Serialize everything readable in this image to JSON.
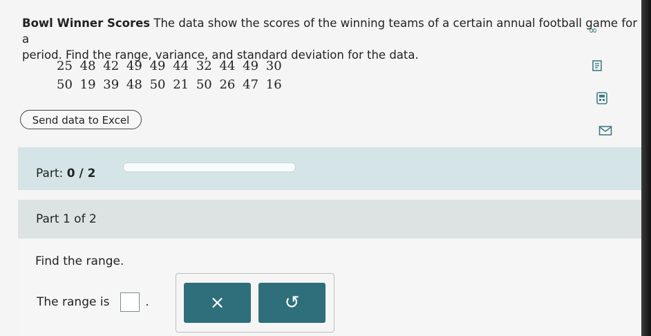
{
  "problem": {
    "title": "Bowl Winner Scores",
    "text": "The data show the scores of the winning teams of a certain annual football game for a",
    "text2": "period. Find the range, variance, and standard deviation for the data."
  },
  "data": {
    "row1": [
      "25",
      "48",
      "42",
      "49",
      "49",
      "44",
      "32",
      "44",
      "49",
      "30"
    ],
    "row2": [
      "50",
      "19",
      "39",
      "48",
      "50",
      "21",
      "50",
      "26",
      "47",
      "16"
    ]
  },
  "excel_button": "Send data to Excel",
  "side_icons": [
    "infinity-icon",
    "worksheet-icon",
    "calculator-icon",
    "mail-icon"
  ],
  "part_progress": {
    "label": "Part:",
    "current": "0 / 2",
    "value": 0
  },
  "part_heading": "Part 1 of 2",
  "question": {
    "prompt": "Find the range.",
    "answer_label": "The range is",
    "answer_value": "",
    "period": "."
  },
  "tools": {
    "clear": "×",
    "undo": "↺"
  },
  "colors": {
    "teal": "#2e6f7b",
    "part_bar": "#d5e4e7"
  }
}
